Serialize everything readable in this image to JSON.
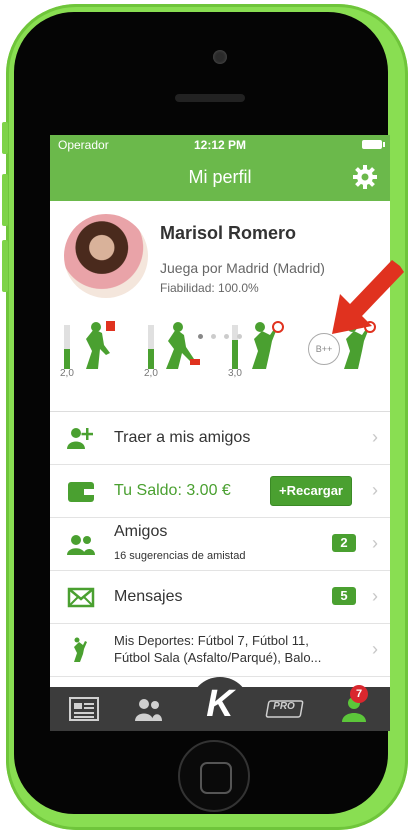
{
  "status_bar": {
    "carrier": "Operador",
    "time": "12:12 PM"
  },
  "nav": {
    "title": "Mi perfil"
  },
  "profile": {
    "name": "Marisol Romero",
    "plays_for": "Juega por Madrid (Madrid)",
    "reliability": "Fiabilidad: 100.0%"
  },
  "sports": [
    {
      "level": "2,0",
      "fill": 0.45
    },
    {
      "level": "2,0",
      "fill": 0.45
    },
    {
      "level": "3,0",
      "fill": 0.65
    },
    {
      "level": "",
      "fill": 0,
      "badge": "B++"
    }
  ],
  "pagination": {
    "pages": 4,
    "current": 1
  },
  "menu": {
    "invite": "Traer a mis amigos",
    "balance": "Tu Saldo: 3.00 €",
    "recharge": "+Recargar",
    "friends": "Amigos",
    "friends_sub": "16 sugerencias de amistad",
    "friends_count": "2",
    "messages": "Mensajes",
    "messages_count": "5",
    "sports": "Mis Deportes: Fútbol 7, Fútbol 11, Fútbol Sala (Asfalto/Parqué), Balo..."
  },
  "tabbar": {
    "center_logo": "K",
    "pro": "PRO",
    "profile_badge": "7"
  },
  "colors": {
    "brand_green": "#6bb94b",
    "accent_green": "#4aa030",
    "arrow_red": "#e0321f",
    "phone_shell": "#89de52"
  }
}
